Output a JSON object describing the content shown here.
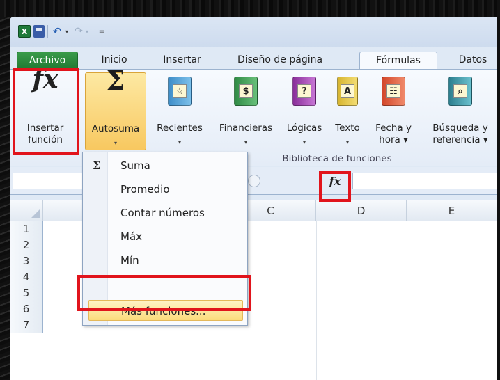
{
  "quick_access": {
    "app_icon": "X",
    "undo_icon": "↶",
    "redo_icon": "↷",
    "dropdown": "▾",
    "customize": "="
  },
  "tabs": [
    "Archivo",
    "Inicio",
    "Insertar",
    "Diseño de página",
    "Fórmulas",
    "Datos"
  ],
  "ribbon": {
    "insert_function": {
      "line1": "Insertar",
      "line2": "función",
      "glyph": "fx"
    },
    "autosum": {
      "label": "Autosuma",
      "glyph": "Σ"
    },
    "recent": {
      "label": "Recientes",
      "glyph": "☆"
    },
    "financial": {
      "label": "Financieras",
      "glyph": "$"
    },
    "logical": {
      "label": "Lógicas",
      "glyph": "?"
    },
    "text": {
      "label": "Texto",
      "glyph": "A"
    },
    "datetime": {
      "line1": "Fecha y",
      "line2": "hora ▾",
      "glyph": "☷"
    },
    "lookup": {
      "line1": "Búsqueda y",
      "line2": "referencia ▾",
      "glyph": "⌕"
    },
    "group_label": "Biblioteca de funciones",
    "arrow": "▾"
  },
  "formula_bar": {
    "fx_label": "fx"
  },
  "grid": {
    "columns": [
      "C",
      "D",
      "E"
    ],
    "rows": [
      "1",
      "2",
      "3",
      "4",
      "5",
      "6",
      "7"
    ]
  },
  "menu": {
    "sum_icon": "Σ",
    "items": [
      {
        "label": "Suma"
      },
      {
        "label": "Promedio"
      },
      {
        "label": "Contar números"
      },
      {
        "label": "Máx"
      },
      {
        "label": "Mín"
      },
      {
        "label": "Más funciones..."
      }
    ]
  },
  "colors": {
    "highlight_red": "#e1141c",
    "file_tab_green": "#217a33",
    "hover_gold": "#f8c860"
  }
}
